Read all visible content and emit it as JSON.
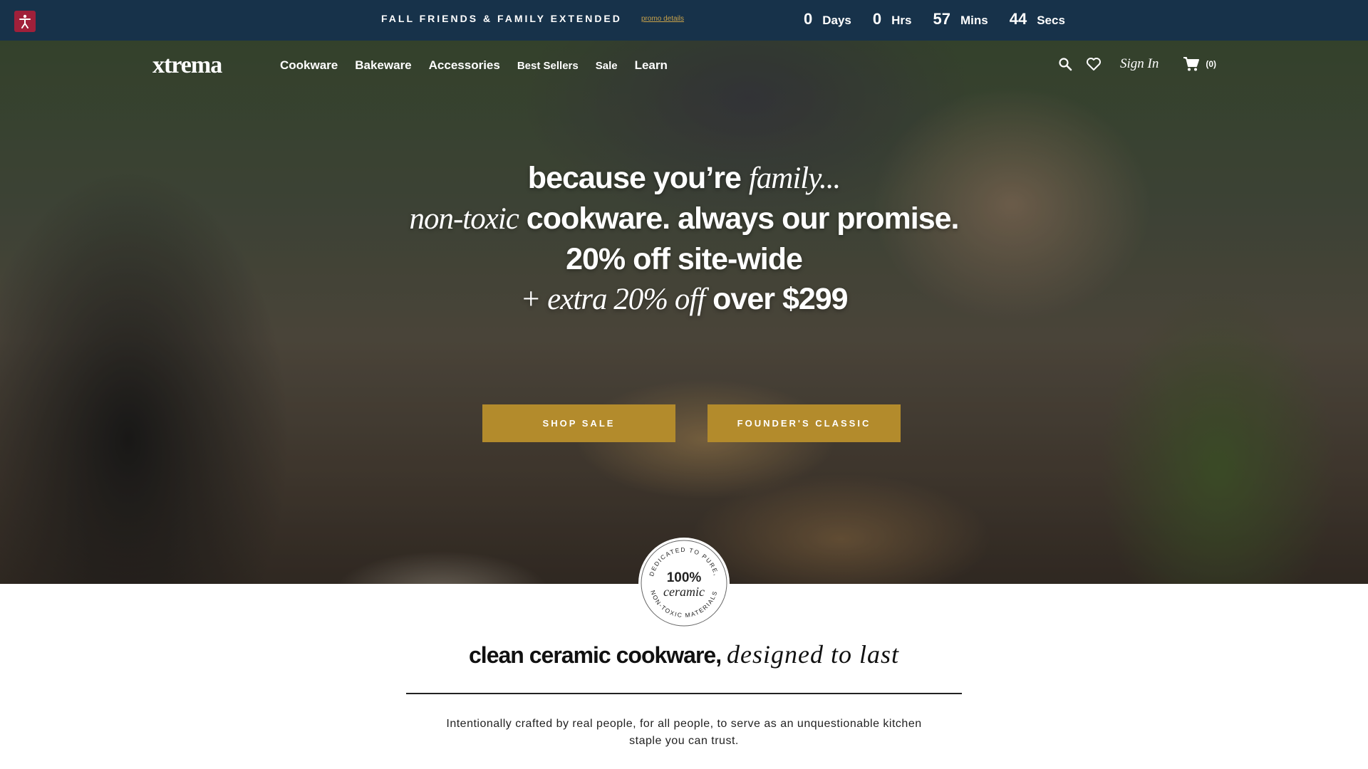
{
  "announcement": {
    "promo_text": "FALL FRIENDS & FAMILY EXTENDED",
    "promo_link": "promo details",
    "countdown": [
      {
        "value": "0",
        "label": "Days"
      },
      {
        "value": "0",
        "label": "Hrs"
      },
      {
        "value": "57",
        "label": "Mins"
      },
      {
        "value": "44",
        "label": "Secs"
      }
    ]
  },
  "nav": {
    "logo": "xtrema",
    "links": [
      "Cookware",
      "Bakeware",
      "Accessories",
      "Best Sellers",
      "Sale",
      "Learn"
    ],
    "sign_in": "Sign In",
    "cart_count": "(0)"
  },
  "hero": {
    "line1_a": "because you’re ",
    "line1_b": "family...",
    "line2_a": "non-toxic",
    "line2_b": " cookware. always our promise.",
    "line3": "20% off site-wide",
    "line4_a": "+ extra 20% off",
    "line4_b": " over $299",
    "cta_primary": "SHOP SALE",
    "cta_secondary": "FOUNDER'S CLASSIC"
  },
  "badge": {
    "top_arc": "DEDICATED TO PURE,",
    "bottom_arc": "NON-TOXIC MATERIALS",
    "number": "100%",
    "word": "ceramic"
  },
  "section": {
    "title_a": "clean ceramic cookware, ",
    "title_b": "designed to last",
    "description": "Intentionally crafted by real people, for all people, to serve as an unquestionable kitchen staple you can trust."
  },
  "colors": {
    "topbar": "#17324a",
    "accent_gold": "#b38b2c",
    "a11y_red": "#a0203a"
  }
}
